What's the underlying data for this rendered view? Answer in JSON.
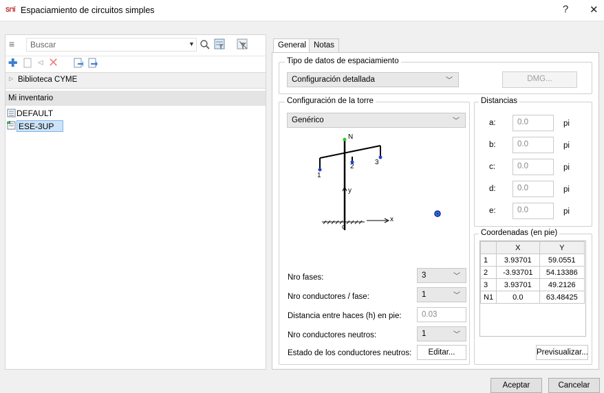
{
  "window": {
    "title": "Espaciamiento de circuitos simples",
    "help": "?",
    "close": "✕",
    "icon_text": "Ѕ⊓Ї"
  },
  "left": {
    "search_placeholder": "Buscar",
    "library_label": "Biblioteca CYME",
    "inventory_label": "Mi inventario",
    "items": [
      "DEFAULT",
      "ESE-3UP"
    ]
  },
  "tabs": [
    {
      "label": "General"
    },
    {
      "label": "Notas"
    }
  ],
  "spacing_type": {
    "legend": "Tipo de datos de espaciamiento",
    "value": "Configuración detallada",
    "dmg_button": "DMG..."
  },
  "tower": {
    "legend": "Configuración de la torre",
    "value": "Genérico"
  },
  "diagram": {
    "n_label": "N",
    "p1": "1",
    "p2": "2",
    "p3": "3",
    "y_label": "y",
    "x_label": "x",
    "origin": "o"
  },
  "distances": {
    "legend": "Distancias",
    "rows": [
      {
        "label": "a:",
        "value": "0.0",
        "unit": "pi"
      },
      {
        "label": "b:",
        "value": "0.0",
        "unit": "pi"
      },
      {
        "label": "c:",
        "value": "0.0",
        "unit": "pi"
      },
      {
        "label": "d:",
        "value": "0.0",
        "unit": "pi"
      },
      {
        "label": "e:",
        "value": "0.0",
        "unit": "pi"
      }
    ]
  },
  "coordinates": {
    "legend": "Coordenadas (en pie)",
    "headers": [
      "",
      "X",
      "Y"
    ],
    "rows": [
      [
        "1",
        "3.93701",
        "59.0551"
      ],
      [
        "2",
        "-3.93701",
        "54.13386"
      ],
      [
        "3",
        "3.93701",
        "49.2126"
      ],
      [
        "N1",
        "0.0",
        "63.48425"
      ]
    ],
    "preview_button": "Previsualizar..."
  },
  "params": {
    "phases_label": "Nro fases:",
    "phases_value": "3",
    "conductors_label": "Nro conductores / fase:",
    "conductors_value": "1",
    "spacing_label": "Distancia entre haces (h) en pie:",
    "spacing_value": "0.03",
    "neutral_label": "Nro conductores neutros:",
    "neutral_value": "1",
    "neutral_state_label": "Estado de los conductores neutros:",
    "edit_button": "Editar..."
  },
  "footer": {
    "accept": "Aceptar",
    "cancel": "Cancelar"
  }
}
